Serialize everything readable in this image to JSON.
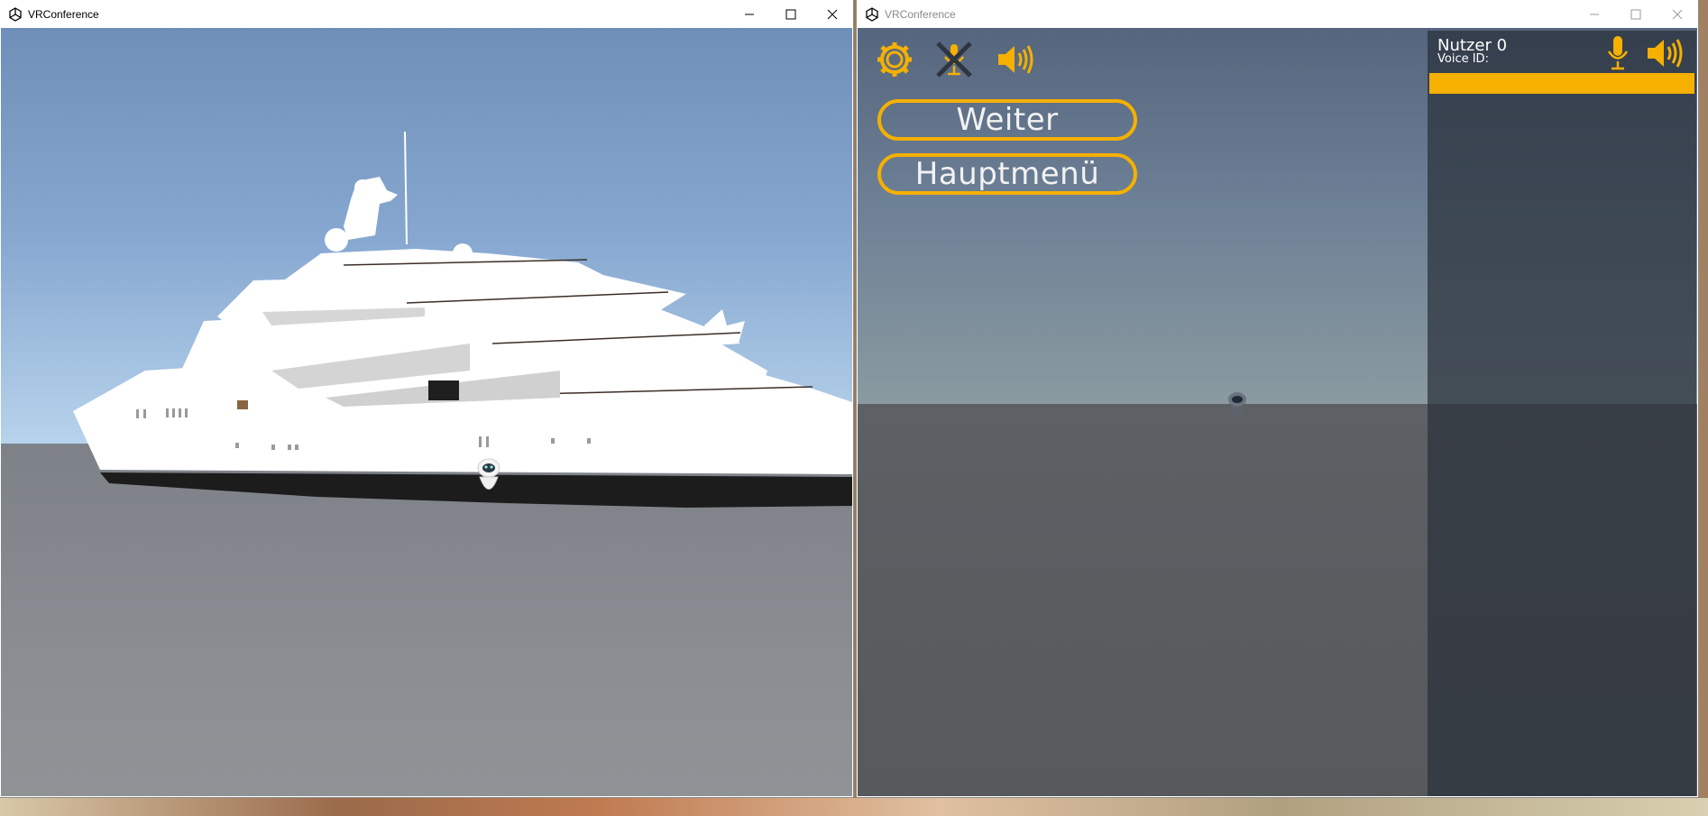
{
  "windows": [
    {
      "title": "VRConference",
      "controls": [
        "minimize",
        "maximize",
        "close"
      ],
      "scene": "yacht-sky-view"
    },
    {
      "title": "VRConference",
      "controls": [
        "minimize",
        "maximize",
        "close"
      ],
      "toolbar_icons": [
        "gear-icon",
        "muted-mic-icon",
        "speaker-icon"
      ],
      "menu": {
        "continue_label": "Weiter",
        "mainmenu_label": "Hauptmenü"
      },
      "user_panel": {
        "name": "Nutzer 0",
        "voice_id": "Voice ID:",
        "icons": [
          "mic-icon",
          "speaker-icon"
        ],
        "level_color": "#f5b000"
      }
    }
  ],
  "colors": {
    "accent": "#f5b000"
  }
}
